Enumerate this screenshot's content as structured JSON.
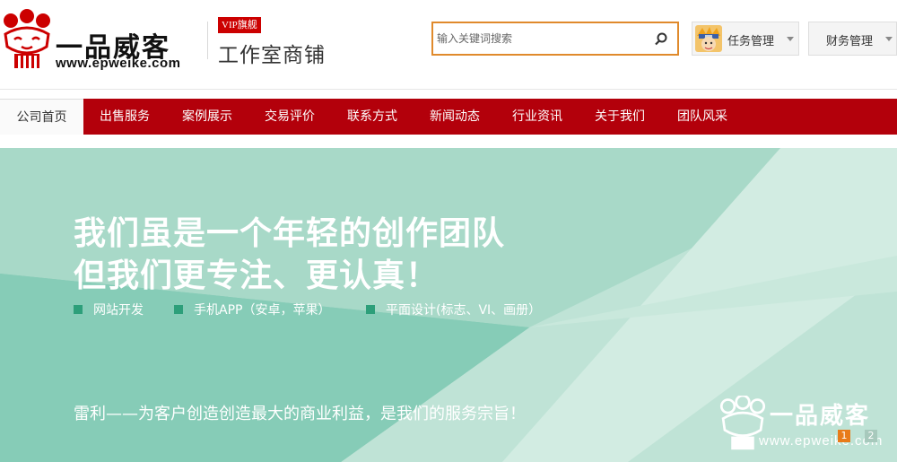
{
  "header": {
    "logo_text": "一品威客",
    "logo_url": "www.epweike.com",
    "vip_badge": "VIP旗舰",
    "shop_name": "工作室商铺"
  },
  "search": {
    "placeholder": "输入关键词搜索",
    "icon": "search-icon"
  },
  "user_menu": {
    "task_label": "任务管理",
    "finance_label": "财务管理"
  },
  "nav": {
    "items": [
      {
        "label": "公司首页",
        "active": true
      },
      {
        "label": "出售服务"
      },
      {
        "label": "案例展示"
      },
      {
        "label": "交易评价"
      },
      {
        "label": "联系方式"
      },
      {
        "label": "新闻动态"
      },
      {
        "label": "行业资讯"
      },
      {
        "label": "关于我们"
      },
      {
        "label": "团队风采"
      }
    ]
  },
  "banner": {
    "headline_1": "我们虽是一个年轻的创作团队",
    "headline_2": "但我们更专注、更认真！",
    "features": [
      "网站开发",
      "手机APP（安卓，苹果）",
      "平面设计(标志、VI、画册）"
    ],
    "slogan_prefix": "雷利——",
    "slogan_text": "为客户创造创造最大的商业利益，是我们的服务宗旨！",
    "watermark_text": "一品威客",
    "watermark_url": "www.epweike.com",
    "pager": [
      "1",
      "2"
    ]
  },
  "colors": {
    "brand_red": "#b3000b",
    "search_border": "#e08a2c",
    "banner_teal": "#7fc8b3"
  }
}
